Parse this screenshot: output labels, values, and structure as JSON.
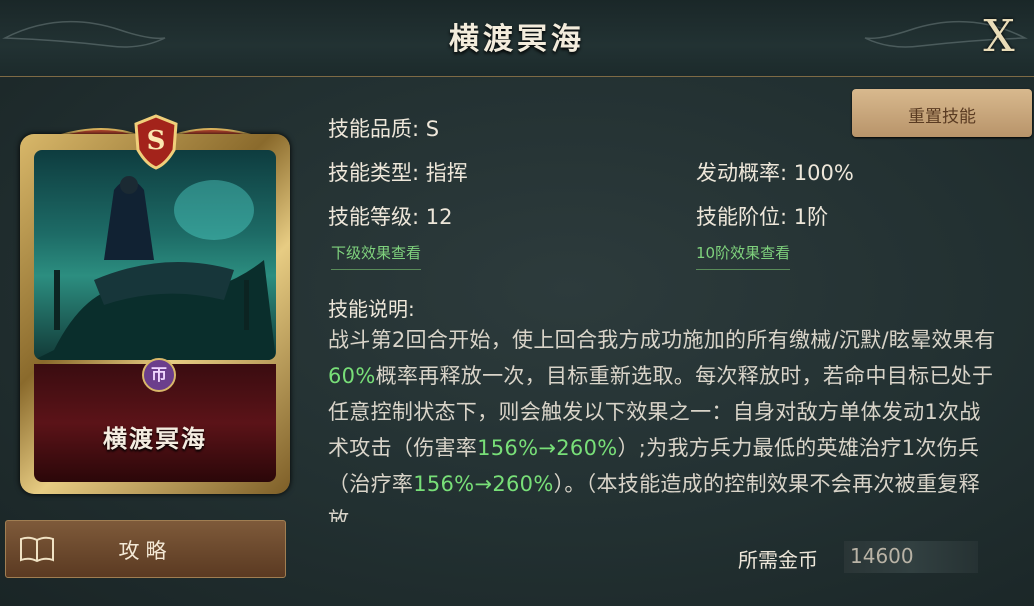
{
  "header": {
    "title": "横渡冥海",
    "close_label": "X"
  },
  "card": {
    "rank": "S",
    "name": "横渡冥海"
  },
  "buttons": {
    "reset": "重置技能",
    "guide": "攻略"
  },
  "stats": {
    "quality": "技能品质: S",
    "type": "技能类型: 指挥",
    "level": "技能等级: 12",
    "chance": "发动概率: 100%",
    "stage": "技能阶位: 1阶"
  },
  "links": {
    "next_level": "下级效果查看",
    "tier10": "10阶效果查看"
  },
  "description": {
    "title": "技能说明:",
    "p1": "战斗第2回合开始，使上回合我方成功施加的所有缴械/沉默/眩晕效果有",
    "h1": "60%",
    "p2": "概率再释放一次，目标重新选取。每次释放时，若命中目标已处于任意控制状态下，则会触发以下效果之一：自身对敌方单体发动1次战术攻击（伤害率",
    "h2": "156%→260%",
    "p3": "）;为我方兵力最低的英雄治疗1次伤兵（治疗率",
    "h3": "156%→260%",
    "p4": "）。（本技能造成的控制效果不会再次被重复释放"
  },
  "cost": {
    "label": "所需金币",
    "value": "14600"
  }
}
